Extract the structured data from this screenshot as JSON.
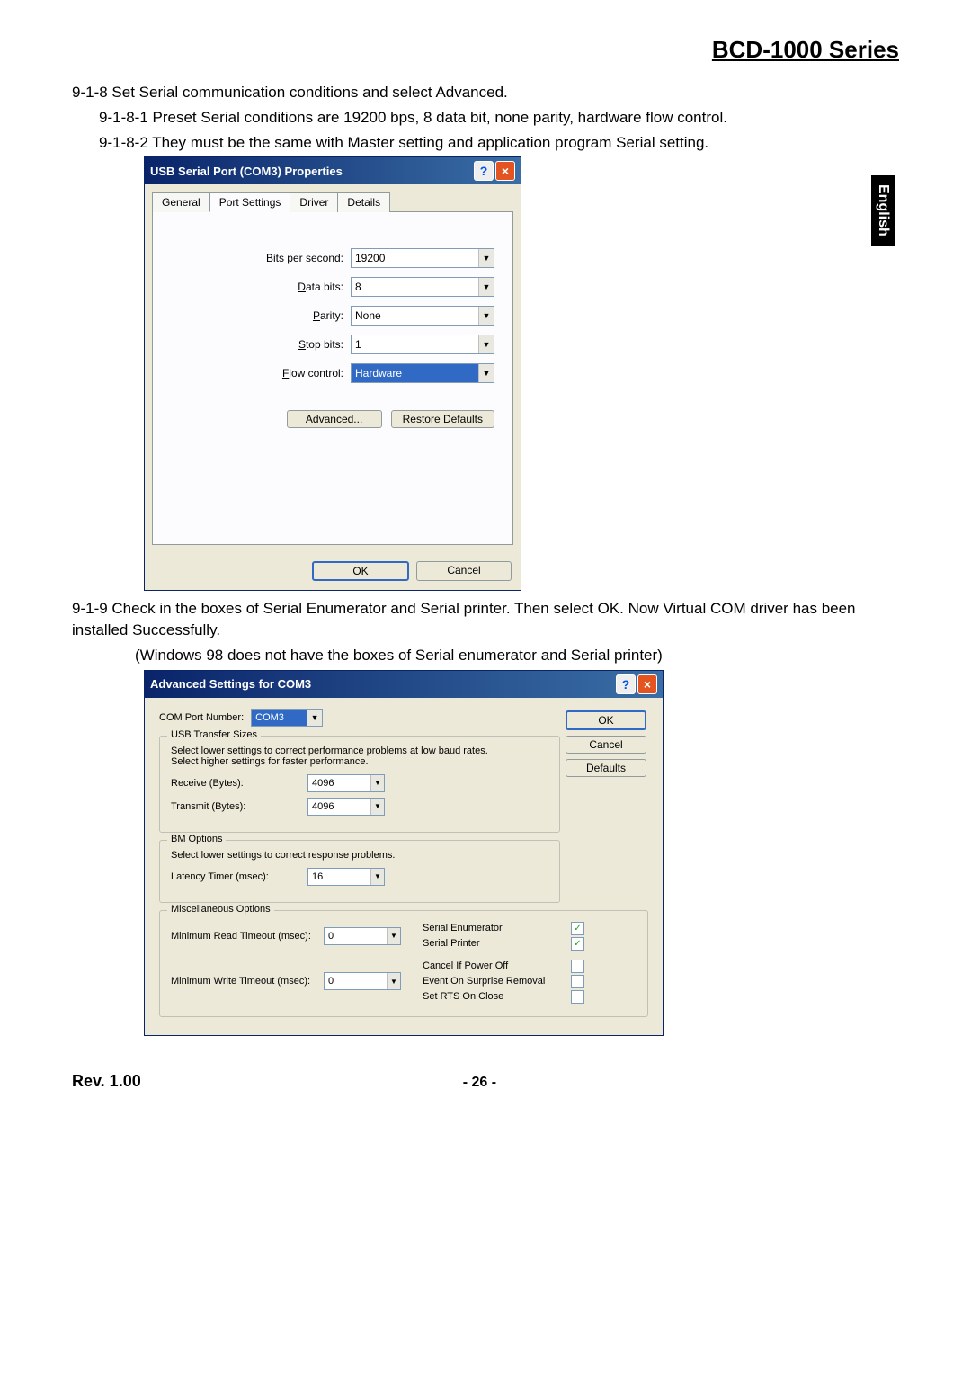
{
  "header": {
    "title": "BCD-1000 Series"
  },
  "side_tab": "English",
  "step918": "9-1-8 Set Serial communication conditions and select Advanced.",
  "step9181": "9-1-8-1 Preset Serial conditions are 19200 bps, 8 data bit, none parity, hardware flow control.",
  "step9182": "9-1-8-2 They must be the same with Master setting and application program Serial setting.",
  "dialog1": {
    "title": "USB Serial Port (COM3) Properties",
    "tabs": [
      "General",
      "Port Settings",
      "Driver",
      "Details"
    ],
    "fields": {
      "bps_label": "Bits per second:",
      "bps_value": "19200",
      "databits_label": "Data bits:",
      "databits_value": "8",
      "parity_label": "Parity:",
      "parity_value": "None",
      "stopbits_label": "Stop bits:",
      "stopbits_value": "1",
      "flow_label": "Flow control:",
      "flow_value": "Hardware"
    },
    "advanced_btn": "Advanced...",
    "restore_btn": "Restore Defaults",
    "ok": "OK",
    "cancel": "Cancel"
  },
  "step919": "9-1-9 Check in the boxes of Serial Enumerator and Serial printer. Then select OK. Now Virtual COM driver has been installed Successfully.",
  "step919_note": "(Windows 98 does not have the boxes of Serial enumerator and Serial printer)",
  "dialog2": {
    "title": "Advanced Settings for COM3",
    "com_label": "COM Port Number:",
    "com_value": "COM3",
    "ok": "OK",
    "cancel": "Cancel",
    "defaults": "Defaults",
    "usb_group": "USB Transfer Sizes",
    "usb_hint": "Select lower settings to correct performance problems at low baud rates.\nSelect higher settings for faster performance.",
    "receive_label": "Receive (Bytes):",
    "receive_value": "4096",
    "transmit_label": "Transmit (Bytes):",
    "transmit_value": "4096",
    "bm_group": "BM Options",
    "bm_hint": "Select lower settings to correct response problems.",
    "latency_label": "Latency Timer (msec):",
    "latency_value": "16",
    "misc_group": "Miscellaneous Options",
    "min_read_label": "Minimum Read Timeout (msec):",
    "min_read_value": "0",
    "min_write_label": "Minimum Write Timeout (msec):",
    "min_write_value": "0",
    "check_serial_enum": "Serial Enumerator",
    "check_serial_printer": "Serial Printer",
    "check_cancel_power": "Cancel If Power Off",
    "check_event_surprise": "Event On Surprise Removal",
    "check_set_rts": "Set RTS On Close"
  },
  "footer": {
    "rev": "Rev. 1.00",
    "page": "- 26 -"
  }
}
